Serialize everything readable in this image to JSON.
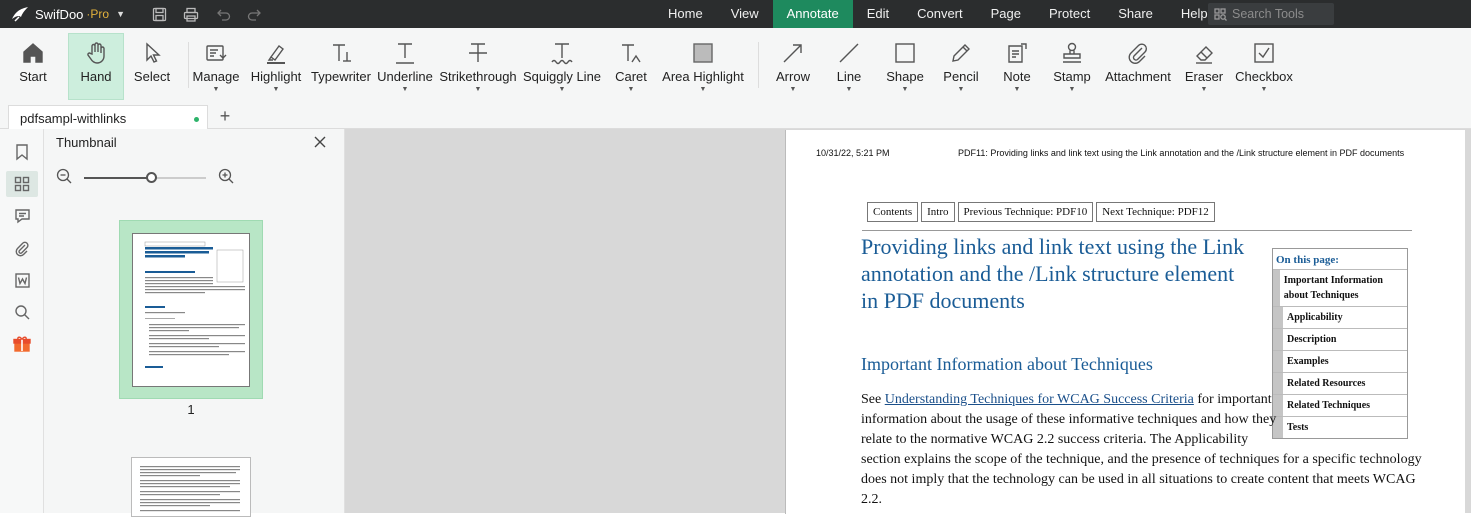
{
  "app": {
    "name": "SwifDoo",
    "edition": "Pro",
    "menu": [
      "Home",
      "View",
      "Annotate",
      "Edit",
      "Convert",
      "Page",
      "Protect",
      "Share",
      "Help"
    ],
    "active_menu": "Annotate",
    "search_placeholder": "Search Tools"
  },
  "toolbar": {
    "start": "Start",
    "hand": "Hand",
    "select": "Select",
    "manage": "Manage",
    "highlight": "Highlight",
    "typewriter": "Typewriter",
    "underline": "Underline",
    "strikethrough": "Strikethrough",
    "squiggly": "Squiggly Line",
    "caret": "Caret",
    "area_highlight": "Area Highlight",
    "arrow": "Arrow",
    "line": "Line",
    "shape": "Shape",
    "pencil": "Pencil",
    "note": "Note",
    "stamp": "Stamp",
    "attachment": "Attachment",
    "eraser": "Eraser",
    "checkbox": "Checkbox"
  },
  "tabs": {
    "current": "pdfsampl-withlinks",
    "add": "+"
  },
  "thumbnail_panel": {
    "title": "Thumbnail",
    "zoom_fraction": 0.55,
    "page_label": "1"
  },
  "document": {
    "header_date": "10/31/22, 5:21 PM",
    "header_title": "PDF11: Providing links and link text using the Link annotation and the /Link structure element in PDF documents",
    "nav": [
      "Contents",
      "Intro",
      "Previous Technique: PDF10",
      "Next Technique: PDF12"
    ],
    "heading_lines": [
      "Providing links and link text using the Link",
      "annotation and the /Link structure element",
      "in PDF documents"
    ],
    "toc_title": "On this page:",
    "toc": [
      "Important Information about Techniques",
      "Applicability",
      "Description",
      "Examples",
      "Related Resources",
      "Related Techniques",
      "Tests"
    ],
    "section_heading": "Important Information about Techniques",
    "para_see": "See ",
    "para_link": "Understanding Techniques for WCAG Success Criteria",
    "para_line1_tail": " for important",
    "para_lines": [
      "information about the usage of these informative techniques and how they",
      "relate to the normative WCAG 2.2 success criteria. The Applicability",
      "section explains the scope of the technique, and the presence of techniques for a specific technology",
      "does not imply that the technology can be used in all situations to create content that meets WCAG",
      "2.2."
    ]
  }
}
